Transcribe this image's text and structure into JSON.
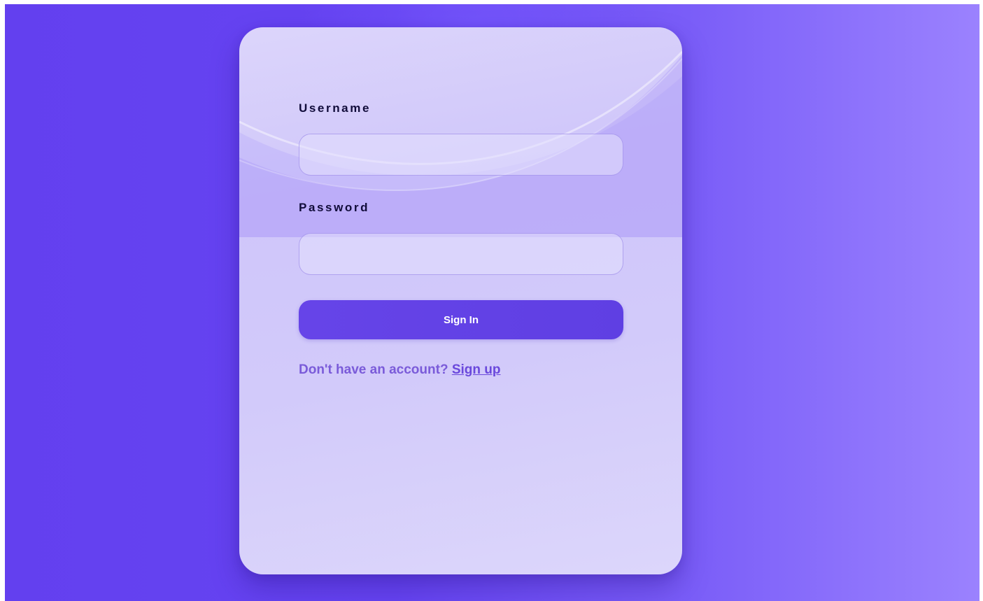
{
  "login_form": {
    "username_label": "Username",
    "username_value": "",
    "password_label": "Password",
    "password_value": "",
    "submit_label": "Sign In",
    "signup_prompt": "Don't have an account?",
    "signup_link": "Sign up"
  },
  "colors": {
    "background_start": "#6340ef",
    "background_end": "#9b82fe",
    "card": "#d8d1fb",
    "button": "#6242e6",
    "label_text": "#110c3a",
    "link_text": "#6a48dc"
  }
}
